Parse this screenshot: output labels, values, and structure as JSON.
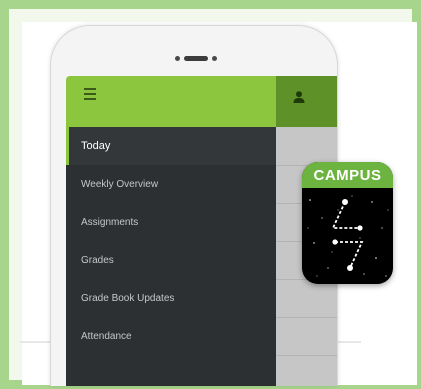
{
  "drawer": {
    "items": [
      {
        "label": "Today",
        "active": true
      },
      {
        "label": "Weekly Overview",
        "active": false
      },
      {
        "label": "Assignments",
        "active": false
      },
      {
        "label": "Grades",
        "active": false
      },
      {
        "label": "Grade Book Updates",
        "active": false
      },
      {
        "label": "Attendance",
        "active": false
      }
    ]
  },
  "badge": {
    "label": "CAMPUS"
  },
  "icons": {
    "menu": "hamburger-menu-icon",
    "user": "user-icon"
  },
  "colors": {
    "frame_border": "#a8d58c",
    "appbar": "#8cc63f",
    "appbar_dark": "#5e9228",
    "drawer_bg": "#2d3033",
    "badge_green": "#6cb33f"
  }
}
